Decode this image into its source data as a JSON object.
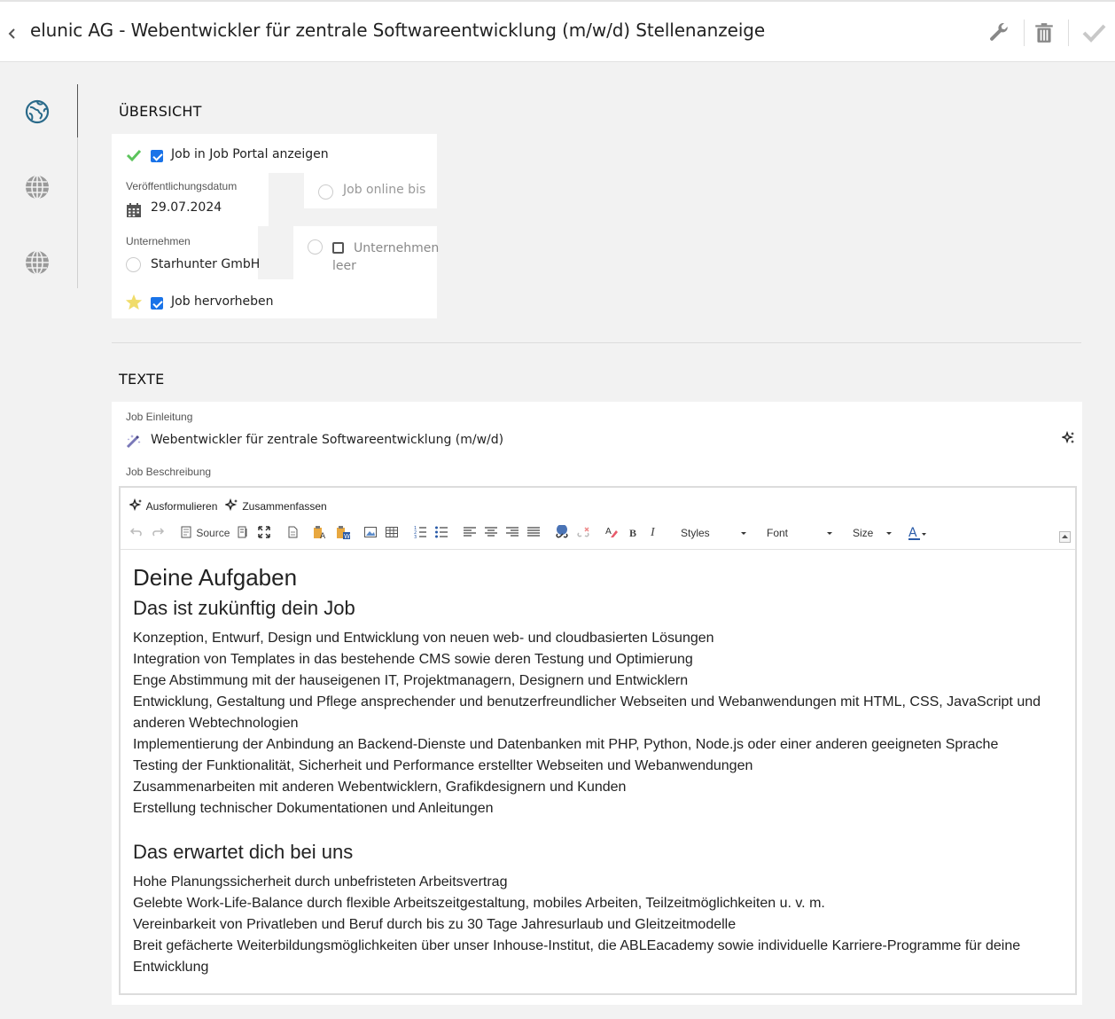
{
  "header": {
    "title": "elunic AG - Webentwickler für zentrale Softwareentwicklung (m/w/d) Stellenanzeige"
  },
  "sidebar": {
    "items": [
      "globe-active",
      "globe",
      "globe"
    ]
  },
  "overview": {
    "section_title": "ÜBERSICHT",
    "show_in_portal_label": "Job in Job Portal anzeigen",
    "publish_date_label": "Veröffentlichungsdatum",
    "publish_date_value": "29.07.2024",
    "online_until_placeholder": "Job online bis",
    "company_label": "Unternehmen",
    "company_value": "Starhunter GmbH",
    "company_empty_label": "Unternehmen leer",
    "highlight_label": "Job hervorheben"
  },
  "texts": {
    "section_title": "TEXTE",
    "intro_label": "Job Einleitung",
    "intro_value": "Webentwickler für zentrale Softwareentwicklung (m/w/d)",
    "description_label": "Job Beschreibung"
  },
  "editor": {
    "ai_buttons": [
      "Ausformulieren",
      "Zusammenfassen"
    ],
    "source_label": "Source",
    "styles_label": "Styles",
    "font_label": "Font",
    "size_label": "Size",
    "content": {
      "h1": "Deine Aufgaben",
      "h2_1": "Das ist zukünftig dein Job",
      "tasks": [
        "Konzeption, Entwurf, Design und Entwicklung von neuen web- und cloudbasierten Lösungen",
        "Integration von Templates in das bestehende CMS sowie deren Testung und Optimierung",
        "Enge Abstimmung mit der hauseigenen IT, Projektmanagern, Designern und Entwicklern",
        "Entwicklung, Gestaltung und Pflege ansprechender und benutzerfreundlicher Webseiten und Webanwendungen mit HTML, CSS, JavaScript und anderen Webtechnologien",
        "Implementierung der Anbindung an Backend-Dienste und Datenbanken mit PHP, Python, Node.js oder einer anderen geeigneten Sprache",
        "Testing der Funktionalität, Sicherheit und Performance erstellter Webseiten und Webanwendungen",
        "Zusammenarbeiten mit anderen Webentwicklern, Grafikdesignern und Kunden",
        "Erstellung technischer Dokumentationen und Anleitungen"
      ],
      "h2_2": "Das erwartet dich bei uns",
      "benefits": [
        "Hohe Planungssicherheit durch unbefristeten Arbeitsvertrag",
        "Gelebte Work-Life-Balance durch flexible Arbeitszeitgestaltung, mobiles Arbeiten, Teilzeitmöglichkeiten u. v. m.",
        "Vereinbarkeit von Privatleben und Beruf durch bis zu 30 Tage Jahresurlaub und Gleitzeitmodelle",
        "Breit gefächerte Weiterbildungsmöglichkeiten über unser Inhouse-Institut, die ABLEacademy sowie individuelle Karriere-Programme für deine Entwicklung"
      ]
    }
  },
  "colors": {
    "checkbox_blue": "#1a73e8",
    "check_green": "#5cc45c",
    "star_yellow": "#f5e27a",
    "icon_teal": "#2a6a8a"
  }
}
